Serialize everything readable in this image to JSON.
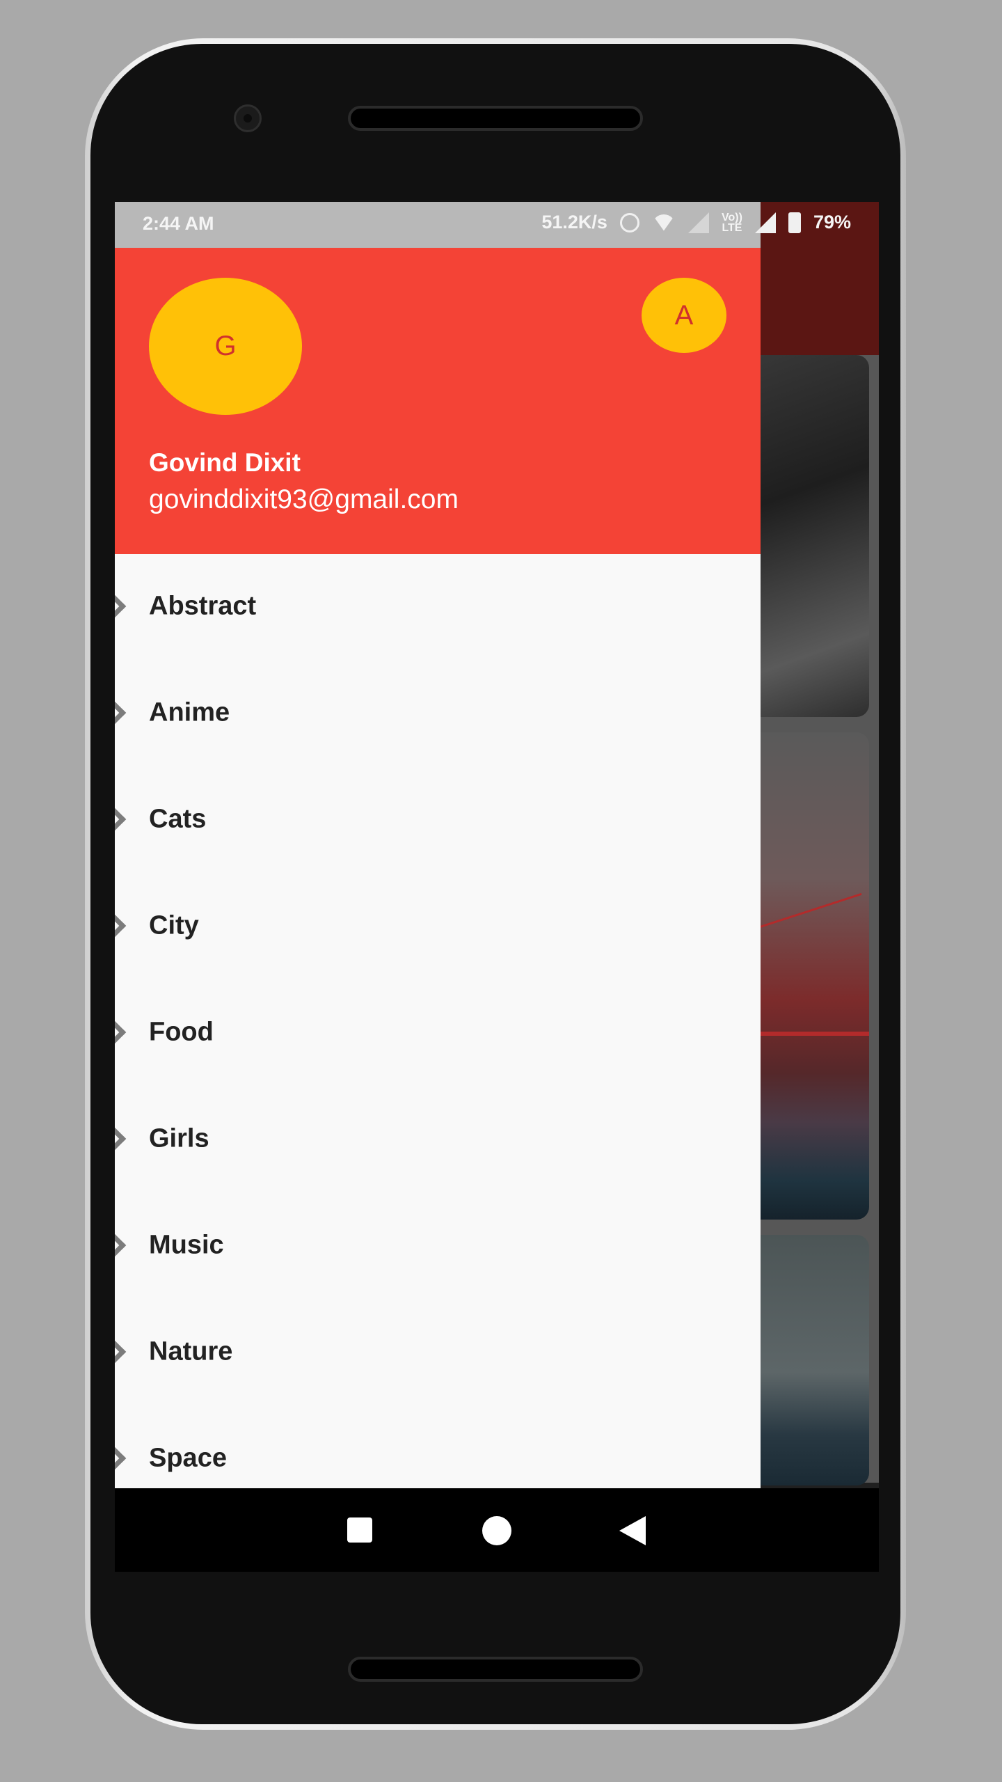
{
  "status_bar": {
    "time": "2:44 AM",
    "net_speed": "51.2K/s",
    "volte": "Vo)) LTE",
    "battery": "79%",
    "icons": [
      "alarm-icon",
      "wifi-icon",
      "signal-icon",
      "volte-icon",
      "signal-icon",
      "battery-charging-icon"
    ]
  },
  "drawer": {
    "account": {
      "avatar_letter": "G",
      "other_account_letter": "A",
      "name": "Govind Dixit",
      "email": "govinddixit93@gmail.com"
    },
    "items": [
      {
        "label": "Abstract"
      },
      {
        "label": "Anime"
      },
      {
        "label": "Cats"
      },
      {
        "label": "City"
      },
      {
        "label": "Food"
      },
      {
        "label": "Girls"
      },
      {
        "label": "Music"
      },
      {
        "label": "Nature"
      },
      {
        "label": "Space"
      }
    ]
  },
  "colors": {
    "header": "#f44336",
    "avatar": "#ffc107",
    "avatar_text": "#d0312d",
    "drawer_bg": "#f9f9f9",
    "chevron": "#7c7c7c"
  },
  "nav_bar": {
    "icons": [
      "recents-square-icon",
      "home-circle-icon",
      "back-triangle-icon"
    ]
  }
}
